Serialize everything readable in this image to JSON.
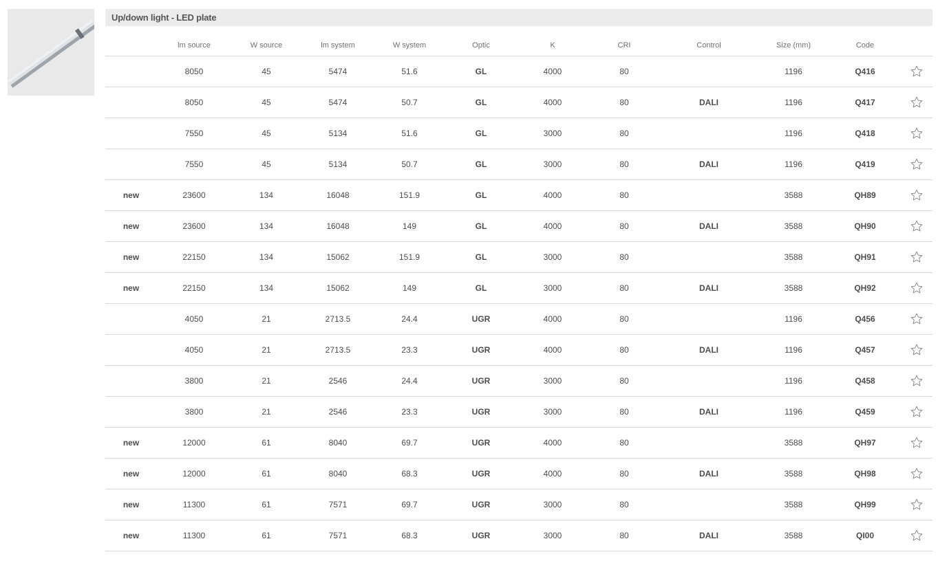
{
  "product": {
    "title": "Up/down light - LED plate",
    "image": "led-plate-luminaire-thumbnail"
  },
  "colors": {
    "title_bar_bg": "#ececec",
    "new_badge": "#cf1e3c",
    "rule": "#d6d6d6"
  },
  "icons": {
    "favorite": "star-outline-icon"
  },
  "table": {
    "headers": {
      "new": "",
      "lm_source": "lm source",
      "w_source": "W source",
      "lm_system": "lm system",
      "w_system": "W system",
      "optic": "Optic",
      "k": "K",
      "cri": "CRI",
      "control": "Control",
      "size": "Size (mm)",
      "code": "Code",
      "fav": ""
    },
    "rows": [
      {
        "new": "",
        "lm_source": "8050",
        "w_source": "45",
        "lm_system": "5474",
        "w_system": "51.6",
        "optic": "GL",
        "k": "4000",
        "cri": "80",
        "control": "",
        "size": "1196",
        "code": "Q416"
      },
      {
        "new": "",
        "lm_source": "8050",
        "w_source": "45",
        "lm_system": "5474",
        "w_system": "50.7",
        "optic": "GL",
        "k": "4000",
        "cri": "80",
        "control": "DALI",
        "size": "1196",
        "code": "Q417"
      },
      {
        "new": "",
        "lm_source": "7550",
        "w_source": "45",
        "lm_system": "5134",
        "w_system": "51.6",
        "optic": "GL",
        "k": "3000",
        "cri": "80",
        "control": "",
        "size": "1196",
        "code": "Q418"
      },
      {
        "new": "",
        "lm_source": "7550",
        "w_source": "45",
        "lm_system": "5134",
        "w_system": "50.7",
        "optic": "GL",
        "k": "3000",
        "cri": "80",
        "control": "DALI",
        "size": "1196",
        "code": "Q419"
      },
      {
        "new": "new",
        "lm_source": "23600",
        "w_source": "134",
        "lm_system": "16048",
        "w_system": "151.9",
        "optic": "GL",
        "k": "4000",
        "cri": "80",
        "control": "",
        "size": "3588",
        "code": "QH89"
      },
      {
        "new": "new",
        "lm_source": "23600",
        "w_source": "134",
        "lm_system": "16048",
        "w_system": "149",
        "optic": "GL",
        "k": "4000",
        "cri": "80",
        "control": "DALI",
        "size": "3588",
        "code": "QH90"
      },
      {
        "new": "new",
        "lm_source": "22150",
        "w_source": "134",
        "lm_system": "15062",
        "w_system": "151.9",
        "optic": "GL",
        "k": "3000",
        "cri": "80",
        "control": "",
        "size": "3588",
        "code": "QH91"
      },
      {
        "new": "new",
        "lm_source": "22150",
        "w_source": "134",
        "lm_system": "15062",
        "w_system": "149",
        "optic": "GL",
        "k": "3000",
        "cri": "80",
        "control": "DALI",
        "size": "3588",
        "code": "QH92"
      },
      {
        "new": "",
        "lm_source": "4050",
        "w_source": "21",
        "lm_system": "2713.5",
        "w_system": "24.4",
        "optic": "UGR",
        "k": "4000",
        "cri": "80",
        "control": "",
        "size": "1196",
        "code": "Q456"
      },
      {
        "new": "",
        "lm_source": "4050",
        "w_source": "21",
        "lm_system": "2713.5",
        "w_system": "23.3",
        "optic": "UGR",
        "k": "4000",
        "cri": "80",
        "control": "DALI",
        "size": "1196",
        "code": "Q457"
      },
      {
        "new": "",
        "lm_source": "3800",
        "w_source": "21",
        "lm_system": "2546",
        "w_system": "24.4",
        "optic": "UGR",
        "k": "3000",
        "cri": "80",
        "control": "",
        "size": "1196",
        "code": "Q458"
      },
      {
        "new": "",
        "lm_source": "3800",
        "w_source": "21",
        "lm_system": "2546",
        "w_system": "23.3",
        "optic": "UGR",
        "k": "3000",
        "cri": "80",
        "control": "DALI",
        "size": "1196",
        "code": "Q459"
      },
      {
        "new": "new",
        "lm_source": "12000",
        "w_source": "61",
        "lm_system": "8040",
        "w_system": "69.7",
        "optic": "UGR",
        "k": "4000",
        "cri": "80",
        "control": "",
        "size": "3588",
        "code": "QH97"
      },
      {
        "new": "new",
        "lm_source": "12000",
        "w_source": "61",
        "lm_system": "8040",
        "w_system": "68.3",
        "optic": "UGR",
        "k": "4000",
        "cri": "80",
        "control": "DALI",
        "size": "3588",
        "code": "QH98"
      },
      {
        "new": "new",
        "lm_source": "11300",
        "w_source": "61",
        "lm_system": "7571",
        "w_system": "69.7",
        "optic": "UGR",
        "k": "3000",
        "cri": "80",
        "control": "",
        "size": "3588",
        "code": "QH99"
      },
      {
        "new": "new",
        "lm_source": "11300",
        "w_source": "61",
        "lm_system": "7571",
        "w_system": "68.3",
        "optic": "UGR",
        "k": "3000",
        "cri": "80",
        "control": "DALI",
        "size": "3588",
        "code": "QI00"
      }
    ]
  }
}
